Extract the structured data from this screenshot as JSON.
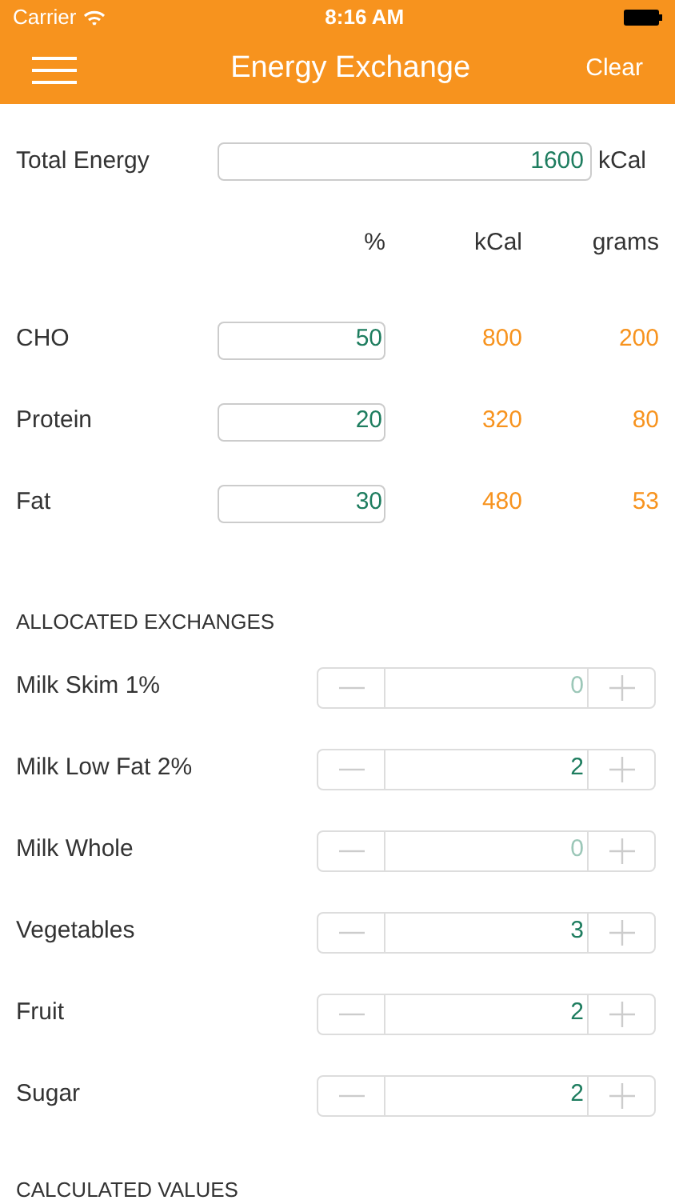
{
  "status_bar": {
    "carrier": "Carrier",
    "time": "8:16 AM"
  },
  "nav": {
    "title": "Energy Exchange",
    "action": "Clear"
  },
  "total_energy": {
    "label": "Total Energy",
    "value": "1600",
    "unit": "kCal"
  },
  "macro_columns": [
    "%",
    "kCal",
    "grams"
  ],
  "macros": [
    {
      "name": "CHO",
      "percent": "50",
      "kcal": "800",
      "grams": "200"
    },
    {
      "name": "Protein",
      "percent": "20",
      "kcal": "320",
      "grams": "80"
    },
    {
      "name": "Fat",
      "percent": "30",
      "kcal": "480",
      "grams": "53"
    }
  ],
  "allocated_exchanges": {
    "title": "ALLOCATED EXCHANGES",
    "items": [
      {
        "name": "Milk Skim 1%",
        "value": "0",
        "dimmed": true
      },
      {
        "name": "Milk Low Fat 2%",
        "value": "2",
        "dimmed": false
      },
      {
        "name": "Milk Whole",
        "value": "0",
        "dimmed": true
      },
      {
        "name": "Vegetables",
        "value": "3",
        "dimmed": false
      },
      {
        "name": "Fruit",
        "value": "2",
        "dimmed": false
      },
      {
        "name": "Sugar",
        "value": "2",
        "dimmed": false
      }
    ]
  },
  "calculated_values": {
    "title": "CALCULATED VALUES"
  }
}
